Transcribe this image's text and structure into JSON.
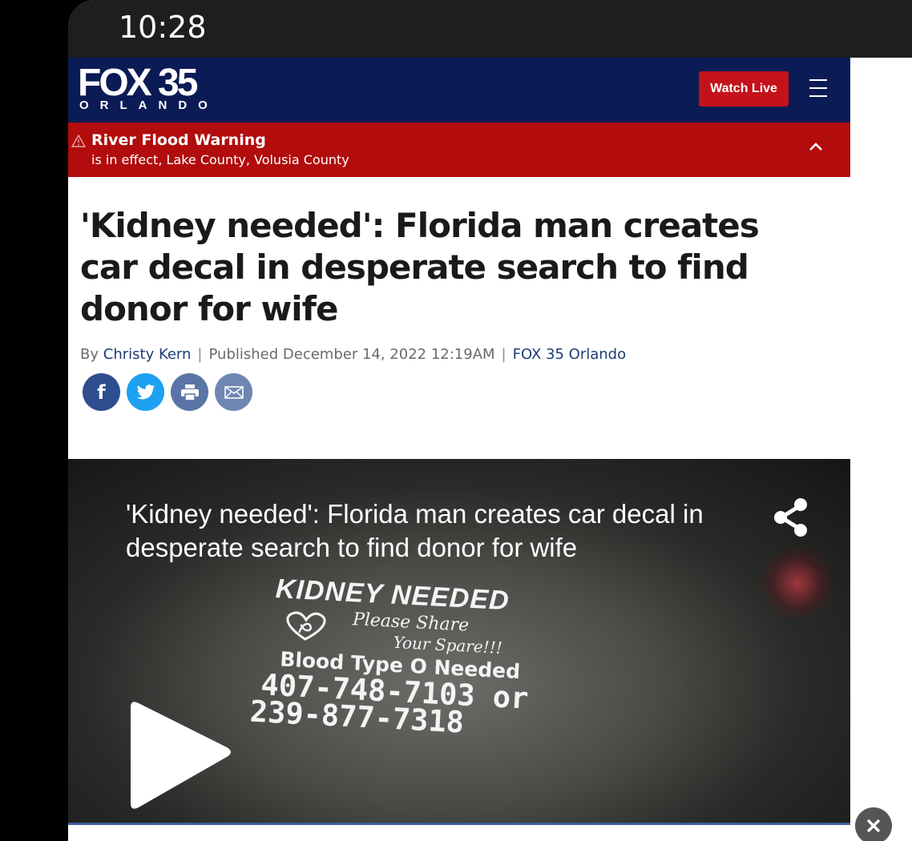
{
  "status_bar": {
    "time": "10:28"
  },
  "header": {
    "logo_main": "FOX 35",
    "logo_sub": "ORLANDO",
    "watch_live_label": "Watch Live"
  },
  "alert": {
    "title": "River Flood Warning",
    "description": "is in effect, Lake County, Volusia County"
  },
  "article": {
    "headline": "'Kidney needed': Florida man creates car decal in desperate search to find donor for wife",
    "byline": {
      "by_prefix": "By",
      "author": "Christy Kern",
      "published": "Published December 14, 2022 12:19AM",
      "source": "FOX 35 Orlando"
    }
  },
  "share_buttons": [
    {
      "name": "facebook",
      "icon": "facebook-icon",
      "glyph": "f"
    },
    {
      "name": "twitter",
      "icon": "twitter-icon"
    },
    {
      "name": "print",
      "icon": "print-icon"
    },
    {
      "name": "email",
      "icon": "email-icon"
    }
  ],
  "video": {
    "title": "'Kidney needed': Florida man creates car decal in desperate search to find donor for wife",
    "decal": {
      "line1": "KIDNEY NEEDED",
      "line2": "Please Share",
      "line3": "Your Spare!!!",
      "line4": "Blood Type O Needed",
      "line5": "407-748-7103 or",
      "line6": "239-877-7318"
    }
  },
  "colors": {
    "header_bg": "#0b1b55",
    "alert_bg": "#b20c0c",
    "watch_live_bg": "#c4121a",
    "link": "#1c3d74"
  }
}
